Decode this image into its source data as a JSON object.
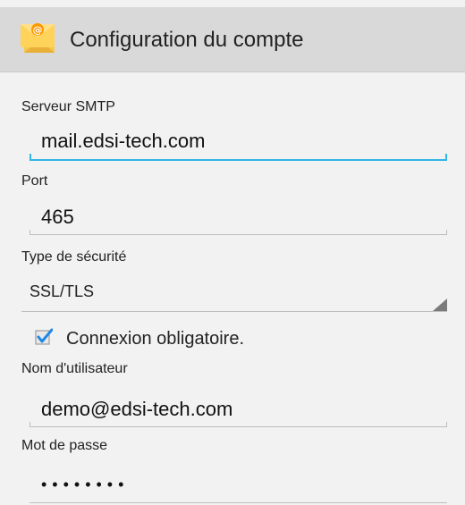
{
  "colors": {
    "action_bar_bg": "#d9d9d9",
    "accent": "#33b5e5",
    "checkbox_blue": "#1e88e5"
  },
  "action_bar": {
    "title": "Configuration du compte",
    "icon": "email-icon"
  },
  "form": {
    "smtp": {
      "label": "Serveur SMTP",
      "value": "mail.edsi-tech.com"
    },
    "port": {
      "label": "Port",
      "value": "465"
    },
    "security": {
      "label": "Type de sécurité",
      "selected": "SSL/TLS",
      "icon": "dropdown-arrow-icon"
    },
    "login_required": {
      "label": "Connexion obligatoire.",
      "checked": true
    },
    "username": {
      "label": "Nom d'utilisateur",
      "value": "demo@edsi-tech.com"
    },
    "password": {
      "label": "Mot de passe",
      "masked": "••••••••"
    }
  }
}
